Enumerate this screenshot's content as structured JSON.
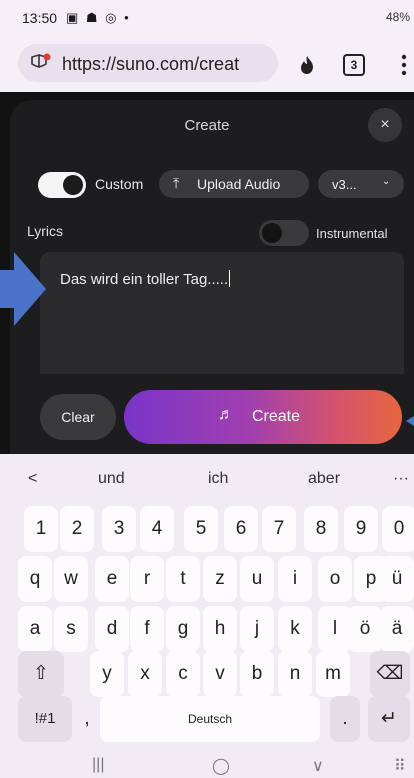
{
  "status_bar": {
    "time": "13:50",
    "left_icons": "▣ ☗ ◎ •",
    "right_text": "48%"
  },
  "browser": {
    "url": "https://suno.com/creat",
    "tab_count": "3"
  },
  "create_panel": {
    "title": "Create",
    "close_label": "×",
    "custom_label": "Custom",
    "upload_label": "Upload Audio",
    "upload_icon": "⤒",
    "version_label": "v3...",
    "version_chevron": "⌄",
    "lyrics_label": "Lyrics",
    "instrumental_label": "Instrumental",
    "lyrics_value": "Das wird ein toller Tag.....",
    "clear_label": "Clear",
    "create_label": "Create",
    "create_icon": "♬"
  },
  "keyboard": {
    "back_chevron": "<",
    "suggestions": [
      "und",
      "ich",
      "aber"
    ],
    "more_dots": "···",
    "row_numbers": [
      "1",
      "2",
      "3",
      "4",
      "5",
      "6",
      "7",
      "8",
      "9",
      "0"
    ],
    "row1": [
      "q",
      "w",
      "e",
      "r",
      "t",
      "z",
      "u",
      "i",
      "o",
      "p",
      "ü"
    ],
    "row2": [
      "a",
      "s",
      "d",
      "f",
      "g",
      "h",
      "j",
      "k",
      "l",
      "ö",
      "ä"
    ],
    "row3": [
      "y",
      "x",
      "c",
      "v",
      "b",
      "n",
      "m"
    ],
    "shift": "⇧",
    "backspace": "⌫",
    "symbols": "!#1",
    "comma": ",",
    "space_label": "Deutsch",
    "period": ".",
    "enter": "↵"
  },
  "nav": {
    "recents": "|||",
    "home": "◯",
    "back": "∨",
    "keyboard_grid": "⠿"
  },
  "colors": {
    "accent_start": "#7a35c8",
    "accent_end": "#e6663f",
    "annotation_blue": "#4a74c9"
  }
}
